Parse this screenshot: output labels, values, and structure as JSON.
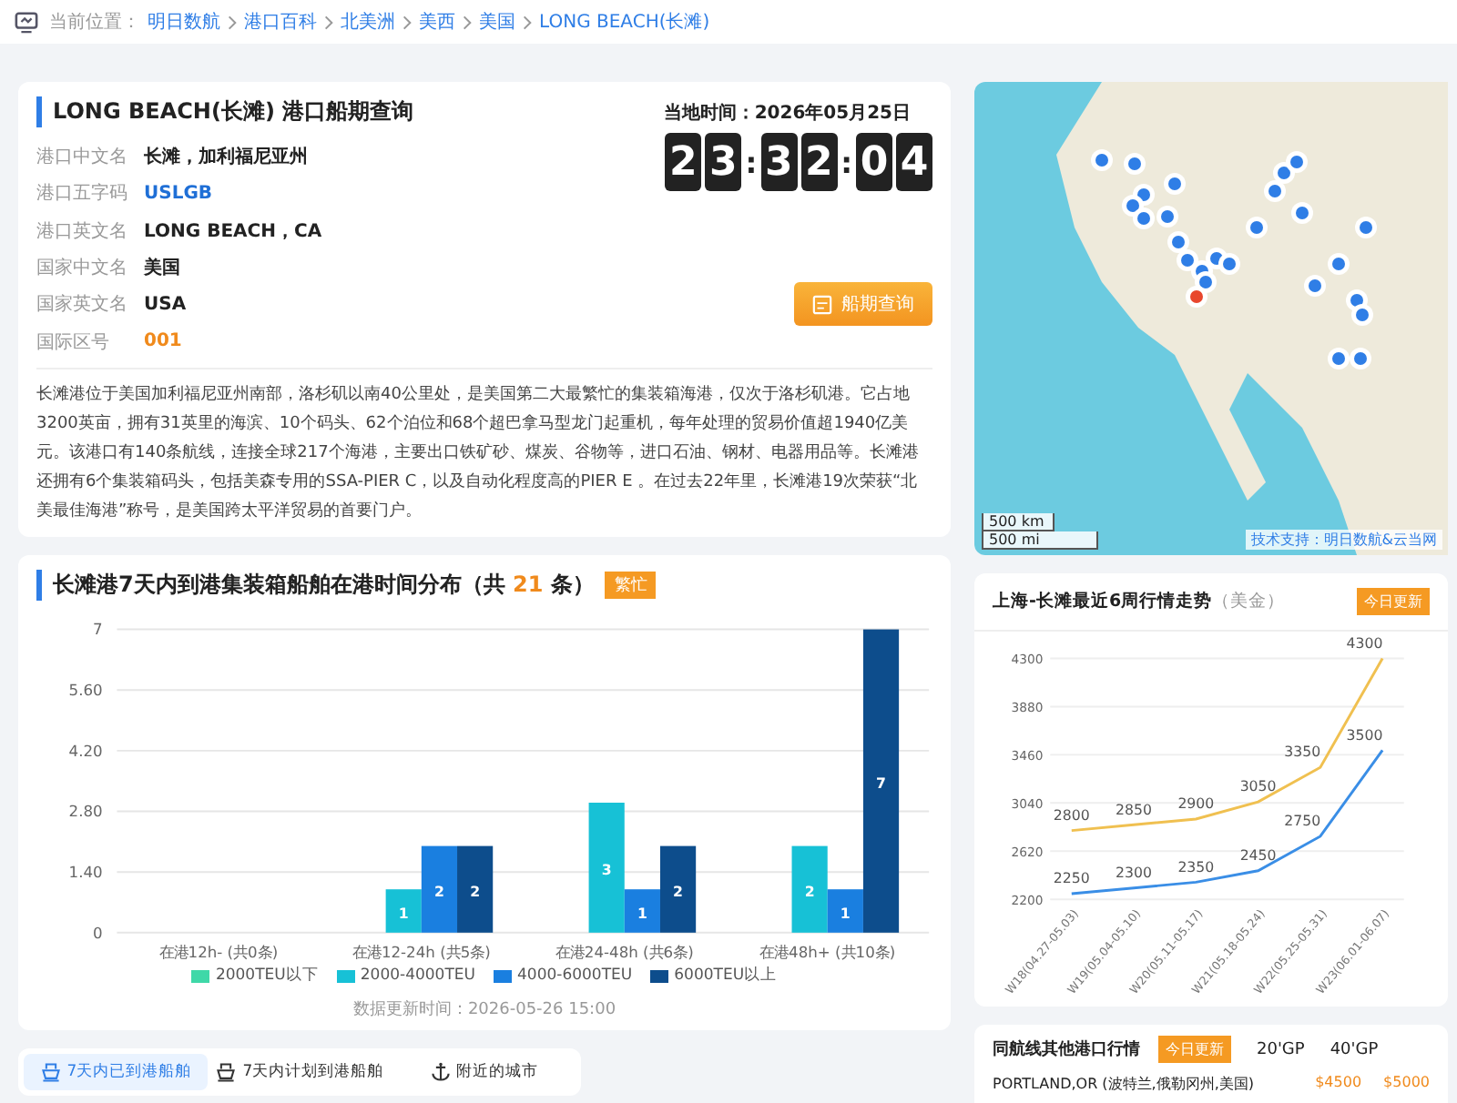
{
  "breadcrumb": {
    "label": "当前位置：",
    "items": [
      "明日数航",
      "港口百科",
      "北美洲",
      "美西",
      "美国",
      "LONG BEACH(长滩)"
    ]
  },
  "port_card": {
    "title": "LONG BEACH(长滩) 港口船期查询",
    "local_time_label": "当地时间：2026年05月25日",
    "clock_groups": [
      [
        "2",
        "3"
      ],
      [
        "3",
        "2"
      ],
      [
        "0",
        "4"
      ]
    ],
    "clock_separator": ":",
    "fields": [
      {
        "label": "港口中文名",
        "value": "长滩，加利福尼亚州",
        "kind": "text"
      },
      {
        "label": "港口五字码",
        "value": "USLGB",
        "kind": "code"
      },
      {
        "label": "港口英文名",
        "value": "LONG BEACH，CA",
        "kind": "text"
      },
      {
        "label": "国家中文名",
        "value": "美国",
        "kind": "text"
      },
      {
        "label": "国家英文名",
        "value": "USA",
        "kind": "text"
      },
      {
        "label": "国际区号",
        "value": "001",
        "kind": "number"
      }
    ],
    "button": "船期查询",
    "description": "长滩港位于美国加利福尼亚州南部，洛杉矶以南40公里处，是美国第二大最繁忙的集装箱海港，仅次于洛杉矶港。它占地3200英亩，拥有31英里的海滨、10个码头、62个泊位和68个超巴拿马型龙门起重机，每年处理的贸易价值超1940亿美元。该港口有140条航线，连接全球217个海港，主要出口铁矿砂、煤炭、谷物等，进口石油、钢材、电器用品等。长滩港还拥有6个集装箱码头，包括美森专用的SSA-PIER C，以及自动化程度高的PIER E 。在过去22年里，长滩港19次荣获“北美最佳海港”称号，是美国跨太平洋贸易的首要门户。"
  },
  "map": {
    "scale_km": "500 km",
    "scale_mi": "500 mi",
    "attribution": "技术支持：明日数航&云当网"
  },
  "distribution": {
    "title": "长滩港7天内到港集装箱船舶在港时间分布（共 **21** 条）",
    "badge": "繁忙",
    "updated": "数据更新时间：2026-05-26 15:00",
    "chart_data": {
      "type": "bar",
      "categories": [
        "在港12h- (共0条)",
        "在港12-24h (共5条)",
        "在港24-48h (共6条)",
        "在港48h+ (共10条)"
      ],
      "series": [
        {
          "name": "2000TEU以下",
          "color": "#3fd8a8",
          "values": [
            0,
            0,
            0,
            0
          ]
        },
        {
          "name": "2000-4000TEU",
          "color": "#17c1d6",
          "values": [
            0,
            1,
            3,
            2
          ]
        },
        {
          "name": "4000-6000TEU",
          "color": "#1a7fe0",
          "values": [
            0,
            2,
            1,
            1
          ]
        },
        {
          "name": "6000TEU以上",
          "color": "#0d4d8c",
          "values": [
            0,
            2,
            2,
            7
          ]
        }
      ],
      "ylim": [
        0,
        7
      ],
      "yticks": [
        0,
        {
          "value": 1.4,
          "label": "1.40"
        },
        {
          "value": 2.8,
          "label": "2.80"
        },
        {
          "value": 4.2,
          "label": "4.20"
        },
        {
          "value": 5.6,
          "label": "5.60"
        },
        7
      ],
      "grid": true,
      "legend": "bottom",
      "value_labels": [
        [
          null,
          null,
          null,
          null
        ],
        [
          null,
          "1",
          "3",
          "2"
        ],
        [
          null,
          "2",
          "1",
          "1"
        ],
        [
          null,
          "2",
          "2",
          "7"
        ]
      ]
    }
  },
  "tabs": [
    {
      "label": "7天内已到港船舶",
      "selected": true,
      "kind": "ship"
    },
    {
      "label": "7天内计划到港船舶",
      "selected": false,
      "kind": "ship"
    },
    {
      "label": "附近的城市",
      "selected": false,
      "kind": "anchor"
    }
  ],
  "trend": {
    "title": "上海-长滩最近6周行情走势",
    "unit": "（美金）",
    "badge": "今日更新",
    "chart_data": {
      "type": "line",
      "categories": [
        "W18(04.27-05.03)",
        "W19(05.04-05.10)",
        "W20(05.11-05.17)",
        "W21(05.18-05.24)",
        "W22(05.25-05.31)",
        "W23(06.01-06.07)"
      ],
      "series": [
        {
          "color": "#f0c050",
          "values": [
            2800,
            2850,
            2900,
            3050,
            3350,
            4300
          ]
        },
        {
          "color": "#3a8ee6",
          "values": [
            2250,
            2300,
            2350,
            2450,
            2750,
            3500
          ]
        }
      ],
      "ylim": [
        2200,
        4300
      ],
      "yticks": [
        2200,
        2620,
        3040,
        3460,
        3880,
        4300
      ],
      "grid": true,
      "data_labels": true
    }
  },
  "other_ports": {
    "title": "同航线其他港口行情",
    "badge": "今日更新",
    "columns": [
      "20'GP",
      "40'GP"
    ],
    "rows": [
      {
        "port": "PORTLAND,OR (波特兰,俄勒冈州,美国)",
        "gp20": "$4500",
        "gp40": "$5000"
      }
    ]
  }
}
